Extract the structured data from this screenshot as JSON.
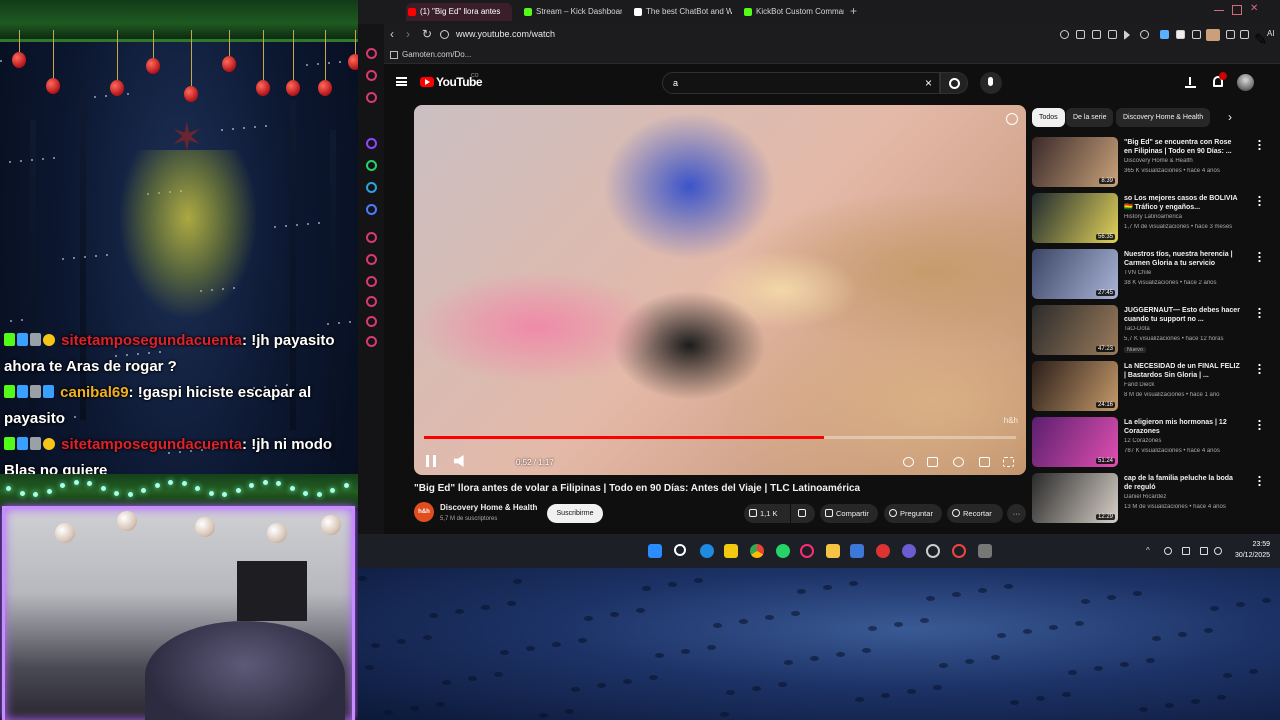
{
  "chat": {
    "messages": [
      {
        "user": "sitetamposegundacuenta",
        "user_color": "#e0212b",
        "text": ": !jh payasito ahora te Aras de rogar ?"
      },
      {
        "user": "canibal69",
        "user_color": "#f3b11c",
        "text": ": !gaspi hiciste escapar al payasito"
      },
      {
        "user": "sitetamposegundacuenta",
        "user_color": "#e0212b",
        "text": ": !jh ni modo Blas no quiere"
      }
    ]
  },
  "browser": {
    "tabs": [
      {
        "label": "(1) \"Big Ed\" llora antes",
        "active": true,
        "icon_color": "#ff0000"
      },
      {
        "label": "Stream – Kick Dashboard",
        "active": false,
        "icon_color": "#53fc18"
      },
      {
        "label": "The best ChatBot and Wi",
        "active": false,
        "icon_color": "#ffffff"
      },
      {
        "label": "KickBot Custom Commands",
        "active": false,
        "icon_color": "#53fc18"
      }
    ],
    "new_tab": "+",
    "url": "www.youtube.com/watch",
    "ai_label": "AI",
    "bookmark": "Gamoten.com/Do..."
  },
  "youtube": {
    "logo": "YouTube",
    "logo_sup": "CO",
    "search_value": "a",
    "clear": "×",
    "video": {
      "time": "0:52 / 1:17",
      "progress": 0.675,
      "watermark": "h&h",
      "title": "\"Big Ed\" llora antes de volar a Filipinas | Todo en 90 Días: Antes del Viaje | TLC Latinoamérica",
      "channel": "Discovery Home & Health",
      "channel_avatar": "h&h",
      "subscribers": "5,7 M de suscriptores",
      "subscribe": "Suscribirme",
      "likes": "1,1 K",
      "share": "Compartir",
      "ask": "Preguntar",
      "clip": "Recortar",
      "more": "···"
    },
    "chips": [
      {
        "label": "Todos",
        "active": true
      },
      {
        "label": "De la serie",
        "active": false
      },
      {
        "label": "Discovery Home & Health",
        "active": false
      }
    ],
    "chips_next": "›",
    "recommendations": [
      {
        "title": "\"Big Ed\" se encuentra con Rose en Filipinas | Todo en 90 Días: ...",
        "channel": "Discovery Home & Health",
        "meta": "365 K visualizaciones • hace 4 años",
        "duration": "8:39",
        "new": "",
        "color1": "#3a2a2a",
        "color2": "#c9a27a"
      },
      {
        "title": "so Los mejores casos de BOLIVIA 🇧🇴 Tráfico y engaños...",
        "channel": "History Latinoamérica",
        "meta": "1,7 M de visualizaciones • hace 3 meses",
        "duration": "56:35",
        "new": "",
        "color1": "#1f2b2f",
        "color2": "#e3d25a"
      },
      {
        "title": "Nuestros tíos, nuestra herencia | Carmen Gloria a tu servicio",
        "channel": "TVN Chile",
        "meta": "38 K visualizaciones • hace 2 años",
        "duration": "27:45",
        "new": "",
        "color1": "#3b4566",
        "color2": "#aab4d6"
      },
      {
        "title": "JUGGERNAUT— Esto debes hacer cuando tu support no ...",
        "channel": "TaO-Dota",
        "meta": "5,7 K visualizaciones • hace 12 horas",
        "duration": "47:23",
        "new": "Nuevo",
        "color1": "#2b2b2b",
        "color2": "#9b7b5b"
      },
      {
        "title": "La NECESIDAD de un FINAL FELIZ | Bastardos Sin Gloria | ...",
        "channel": "Farid Dieck",
        "meta": "8 M de visualizaciones • hace 1 año",
        "duration": "24:16",
        "new": "",
        "color1": "#2a1e1a",
        "color2": "#c59a6a"
      },
      {
        "title": "La eligieron mis hormonas | 12 Corazones",
        "channel": "12 Corazones",
        "meta": "787 K visualizaciones • hace 4 años",
        "duration": "51:24",
        "new": "",
        "color1": "#5a1f6e",
        "color2": "#e04fb0"
      },
      {
        "title": "cap de la familia peluche la boda de reguló",
        "channel": "Daniel Ricardez",
        "meta": "13 M de visualizaciones • hace 4 años",
        "duration": "12:29",
        "new": "",
        "color1": "#2a2a2a",
        "color2": "#d8d0c8"
      }
    ]
  },
  "taskbar": {
    "time": "23:59",
    "date": "30/12/2025"
  },
  "colors": {
    "youtube_red": "#ff0000",
    "kick_green": "#53fc18",
    "webcam_border": "#c98cff"
  }
}
